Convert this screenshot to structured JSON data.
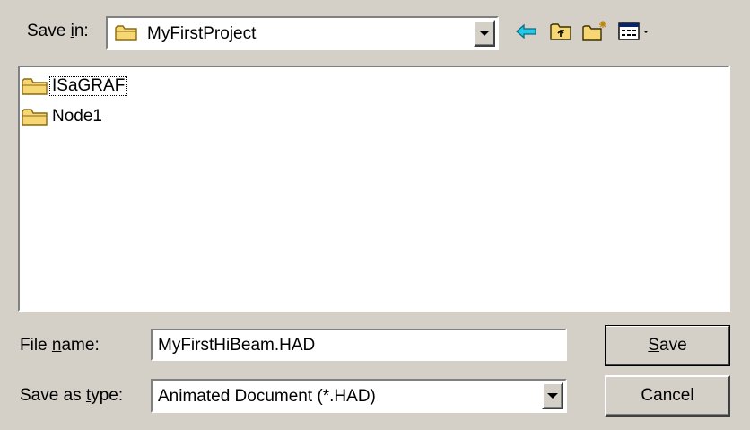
{
  "save_in": {
    "label_prefix": "Save ",
    "label_accel": "i",
    "label_suffix": "n:",
    "folder": "MyFirstProject",
    "icon": "folder-icon"
  },
  "toolbar": {
    "back_icon": "back-arrow-icon",
    "up_icon": "up-one-level-icon",
    "new_folder_icon": "new-folder-icon",
    "view_menu_icon": "view-menu-icon"
  },
  "files": [
    {
      "name": "ISaGRAF",
      "icon": "folder-icon",
      "focused": true
    },
    {
      "name": "Node1",
      "icon": "folder-icon",
      "focused": false
    }
  ],
  "file_name": {
    "label_prefix": "File ",
    "label_accel": "n",
    "label_suffix": "ame:",
    "value": "MyFirstHiBeam.HAD"
  },
  "save_type": {
    "label_prefix": "Save as ",
    "label_accel": "t",
    "label_suffix": "ype:",
    "value": "Animated Document (*.HAD)"
  },
  "buttons": {
    "save_accel": "S",
    "save_rest": "ave",
    "cancel": "Cancel"
  }
}
